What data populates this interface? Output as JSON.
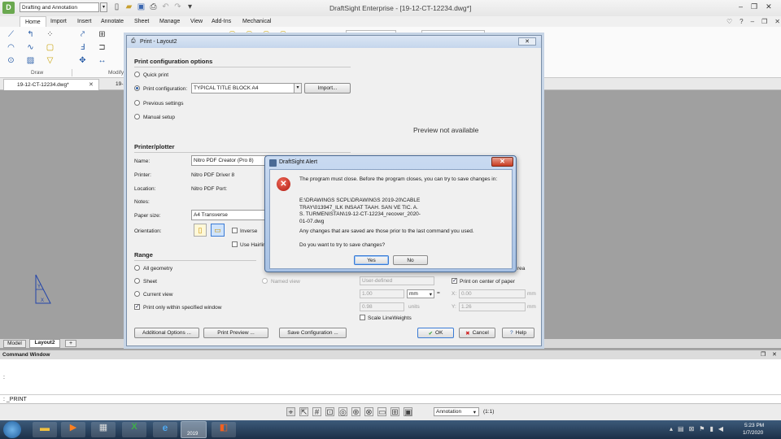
{
  "app": {
    "title": "DraftSight Enterprise - [19-12-CT-12234.dwg*]",
    "workspace": "Drafting and Annotation",
    "menu": [
      "Home",
      "Import",
      "Insert",
      "Annotate",
      "Sheet",
      "Manage",
      "View",
      "Add-Ins",
      "Mechanical"
    ],
    "ribbon_groups": [
      "Draw",
      "Modify"
    ],
    "doc_tab": "19-12-CT-12234.dwg*",
    "doc_tab_2": "19-1",
    "layout_tabs": [
      "Model",
      "Layout2"
    ],
    "annotation_scale": "Annotation",
    "scale_ratio": "(1:1)"
  },
  "command": {
    "title": "Command Window",
    "prompt": ":",
    "last": ": _PRINT"
  },
  "print_dialog": {
    "title": "Print - Layout2",
    "section_config": "Print configuration options",
    "quick_print": "Quick print",
    "print_config_label": "Print configuration:",
    "print_config_value": "TYPICAL TITLE BLOCK A4",
    "import_button": "Import...",
    "previous_settings": "Previous settings",
    "manual_setup": "Manual setup",
    "preview_text": "Preview not available",
    "section_printer": "Printer/plotter",
    "name_label": "Name:",
    "name_value": "Nitro PDF Creator (Pro 8)",
    "printer_label": "Printer:",
    "printer_value": "Nitro PDF Driver 8",
    "location_label": "Location:",
    "location_value": "Nitro PDF Port:",
    "notes_label": "Notes:",
    "paper_label": "Paper size:",
    "paper_value": "A4 Transverse",
    "orientation_label": "Orientation:",
    "inverse": "Inverse",
    "use_hairline": "Use Hairline",
    "section_range": "Range",
    "all_geometry": "All geometry",
    "sheet": "Sheet",
    "current_view": "Current view",
    "named_view": "Named view",
    "print_within_window": "Print only within specified window",
    "area_suffix": "rea",
    "scale_value": "User-defined",
    "mm_value": "1.00",
    "mm_unit": "mm",
    "units_value": "0.98",
    "units_label": "units",
    "print_center": "Print on center of paper",
    "x_label": "X:",
    "x_value": "0.00",
    "y_label": "Y:",
    "y_value": "1.26",
    "mm_suffix": "mm",
    "scale_lineweights": "Scale LineWeights",
    "additional_options": "Additional Options ...",
    "print_preview": "Print Preview ...",
    "save_configuration": "Save Configuration ...",
    "ok": "OK",
    "cancel": "Cancel",
    "help": "Help"
  },
  "alert": {
    "title": "DraftSight Alert",
    "line1": "The program must close. Before the program closes, you can try to save changes in:",
    "path": "E:\\DRAWINGS SCPL\\DRAWINGS 2019-20\\CABLE TRAY\\013947_ILK INSAAT TAAH. SAN VE TIC. A.S. TURMENISTAN\\19-12-CT-12234_recover_2020-01-07.dwg",
    "line2": "Any changes that are saved are those prior to the last command you used.",
    "question": "Do you want to try to save changes?",
    "yes": "Yes",
    "no": "No"
  },
  "taskbar": {
    "badge": "2019",
    "time": "5:23 PM",
    "date": "1/7/2020"
  }
}
